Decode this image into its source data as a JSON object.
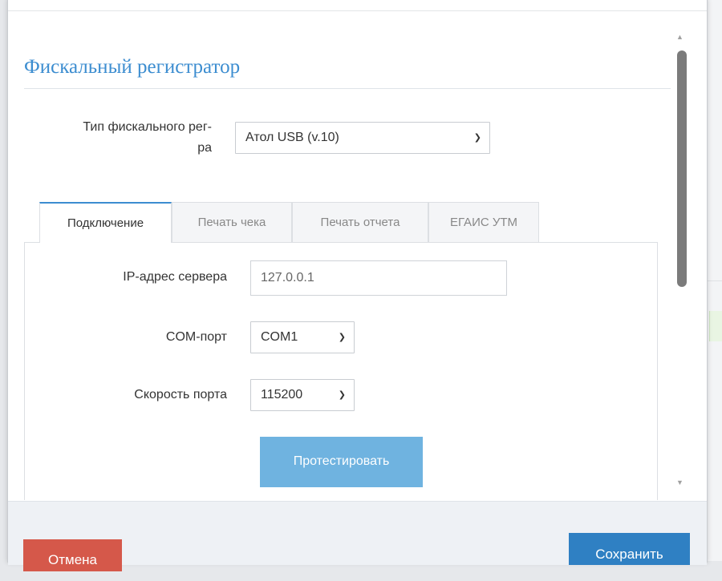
{
  "section": {
    "title": "Фискальный регистратор"
  },
  "register_type": {
    "label": "Тип фискального рег-\nра",
    "selected": "Атол USB (v.10)"
  },
  "tabs": [
    {
      "label": "Подключение",
      "active": true
    },
    {
      "label": "Печать чека",
      "active": false
    },
    {
      "label": "Печать отчета",
      "active": false
    },
    {
      "label": "ЕГАИС УТМ",
      "active": false
    }
  ],
  "connection": {
    "ip_label": "IP-адрес сервера",
    "ip_value": "127.0.0.1",
    "com_label": "COM-порт",
    "com_value": "COM1",
    "speed_label": "Скорость порта",
    "speed_value": "115200",
    "test_button": "Протестировать"
  },
  "footer": {
    "cancel_label": "Отмена",
    "save_label": "Сохранить"
  },
  "icons": {
    "select_chevron": "chevron-down-icon",
    "scroll_up": "scroll-up-arrow-icon",
    "scroll_down": "scroll-down-arrow-icon"
  },
  "colors": {
    "title": "#3c8dd0",
    "test_button": "#6fb3e0",
    "cancel_button": "#d5584a",
    "save_button": "#2f80c3",
    "active_tab_border": "#3c8dd0"
  }
}
